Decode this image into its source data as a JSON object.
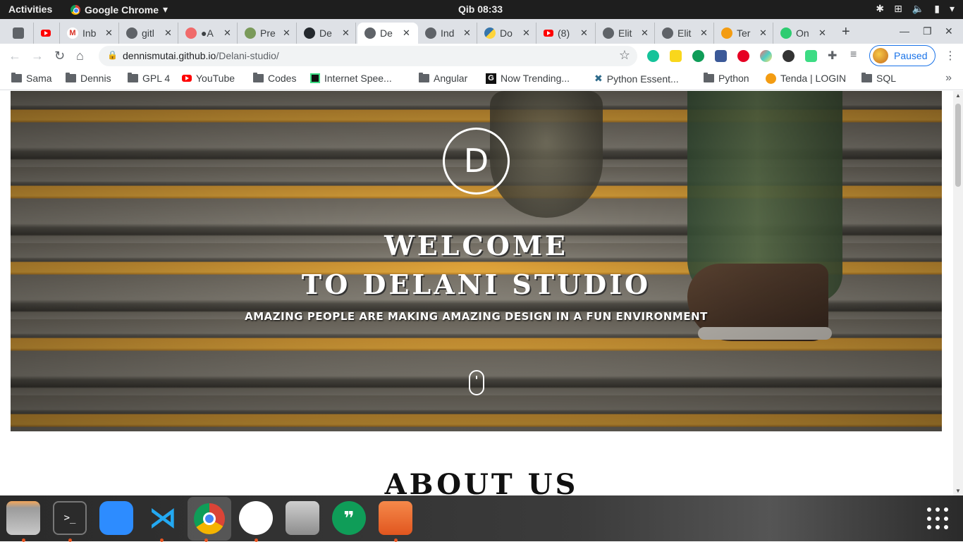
{
  "topbar": {
    "activities": "Activities",
    "app_name": "Google Chrome",
    "clock": "Qib 08:33"
  },
  "tabs": [
    {
      "label": "",
      "icon": "clipboard-icon"
    },
    {
      "label": "",
      "icon": "youtube-icon"
    },
    {
      "label": "Inb",
      "icon": "gmail-icon"
    },
    {
      "label": "gitl",
      "icon": "globe-icon"
    },
    {
      "label": "●A",
      "icon": "asana-icon"
    },
    {
      "label": "Pre",
      "icon": "tree-icon"
    },
    {
      "label": "De",
      "icon": "github-icon"
    },
    {
      "label": "De",
      "icon": "globe-icon",
      "active": true
    },
    {
      "label": "Ind",
      "icon": "globe-icon"
    },
    {
      "label": "Do",
      "icon": "python-icon"
    },
    {
      "label": "(8)",
      "icon": "youtube-icon"
    },
    {
      "label": "Elit",
      "icon": "globe-icon"
    },
    {
      "label": "Elit",
      "icon": "globe-icon"
    },
    {
      "label": "Ter",
      "icon": "tenda-icon"
    },
    {
      "label": "On",
      "icon": "odi-icon"
    }
  ],
  "address": {
    "host": "dennismutai.github.io",
    "path": "/Delani-studio/"
  },
  "profile": {
    "label": "Paused"
  },
  "bookmarks": [
    {
      "label": "Sama",
      "icon": "folder-icon"
    },
    {
      "label": "Dennis",
      "icon": "folder-icon"
    },
    {
      "label": "GPL 4",
      "icon": "folder-icon"
    },
    {
      "label": "YouTube",
      "icon": "youtube-icon"
    },
    {
      "label": "Codes",
      "icon": "folder-icon"
    },
    {
      "label": "Internet Spee...",
      "icon": "speedtest-icon"
    },
    {
      "label": "Angular",
      "icon": "folder-icon"
    },
    {
      "label": "Now Trending...",
      "icon": "g-icon"
    },
    {
      "label": "Python Essent...",
      "icon": "x-icon"
    },
    {
      "label": "Python",
      "icon": "folder-icon"
    },
    {
      "label": "Tenda | LOGIN",
      "icon": "tenda-icon"
    },
    {
      "label": "SQL",
      "icon": "folder-icon"
    }
  ],
  "hero": {
    "logo_letter": "D",
    "welcome_line1": "WELCOME",
    "welcome_line2": "TO DELANI STUDIO",
    "tagline": "AMAZING PEOPLE ARE MAKING AMAZING DESIGN IN A FUN ENVIRONMENT"
  },
  "about": {
    "heading": "ABOUT US"
  },
  "colors": {
    "accent_orange": "#e95420",
    "chrome_blue": "#1a73e8",
    "stripe_yellow": "#f0b240"
  }
}
